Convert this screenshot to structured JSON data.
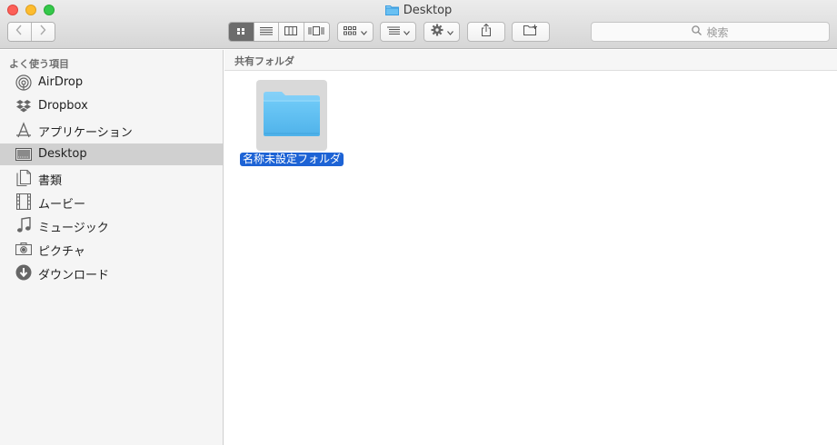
{
  "window": {
    "title": "Desktop"
  },
  "toolbar": {
    "view_modes": [
      {
        "name": "icon-view",
        "active": true
      },
      {
        "name": "list-view",
        "active": false
      },
      {
        "name": "column-view",
        "active": false
      },
      {
        "name": "cover-flow-view",
        "active": false
      }
    ],
    "search": {
      "placeholder": "検索"
    }
  },
  "sidebar": {
    "heading": "よく使う項目",
    "items": [
      {
        "label": "AirDrop",
        "icon": "airdrop-icon",
        "selected": false
      },
      {
        "label": "Dropbox",
        "icon": "dropbox-icon",
        "selected": false
      },
      {
        "label": "アプリケーション",
        "icon": "applications-icon",
        "selected": false
      },
      {
        "label": "Desktop",
        "icon": "desktop-icon",
        "selected": true
      },
      {
        "label": "書類",
        "icon": "documents-icon",
        "selected": false
      },
      {
        "label": "ムービー",
        "icon": "movies-icon",
        "selected": false
      },
      {
        "label": "ミュージック",
        "icon": "music-icon",
        "selected": false
      },
      {
        "label": "ピクチャ",
        "icon": "pictures-icon",
        "selected": false
      },
      {
        "label": "ダウンロード",
        "icon": "downloads-icon",
        "selected": false
      }
    ]
  },
  "main": {
    "path_header": "共有フォルダ",
    "files": [
      {
        "name": "名称未設定フォルダ",
        "type": "folder",
        "selected": true
      }
    ]
  },
  "colors": {
    "selection_blue": "#1d63d5",
    "folder_blue": "#5fc3f4",
    "sidebar_selected": "#d0d0d0"
  }
}
